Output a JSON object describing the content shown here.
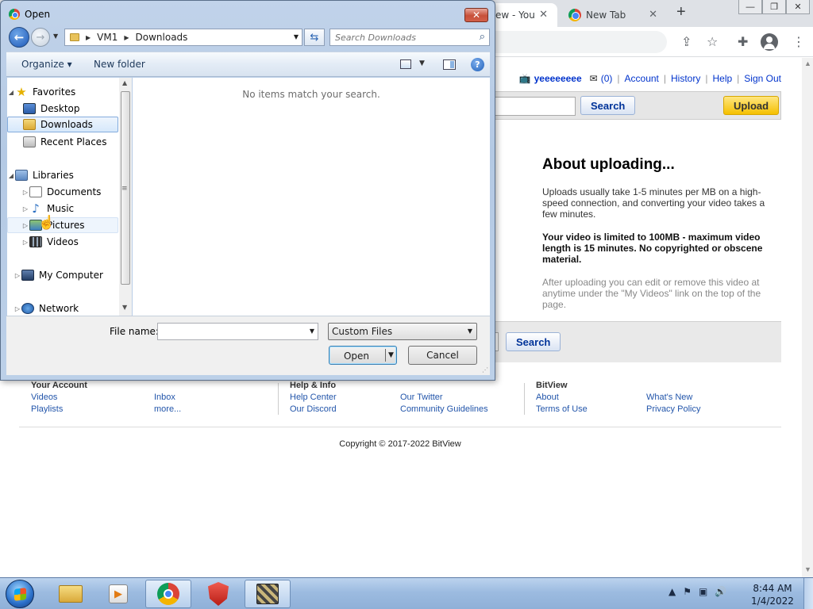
{
  "browser": {
    "tabs": [
      {
        "label": "ew - You"
      },
      {
        "label": "New Tab"
      }
    ]
  },
  "page": {
    "userbar": {
      "username": "yeeeeeeee",
      "messages": "(0)",
      "links": [
        "Account",
        "History",
        "Help",
        "Sign Out"
      ]
    },
    "search_button": "Search",
    "upload_button": "Upload",
    "about": {
      "title": "About uploading...",
      "p1": "Uploads usually take 1-5 minutes per MB on a high-speed connection, and converting your video takes a few minutes.",
      "p2": "Your video is limited to 100MB - maximum video length is 15 minutes. No copyrighted or obscene material.",
      "p3": "After uploading you can edit or remove this video at anytime under the \"My Videos\" link on the top of the page."
    },
    "bottom_search_button": "Search",
    "footer": {
      "col1": {
        "heading": "Your Account",
        "links_a": [
          "Videos",
          "Playlists"
        ],
        "links_b": [
          "Inbox",
          "more..."
        ]
      },
      "col2": {
        "heading": "Help & Info",
        "links_a": [
          "Help Center",
          "Our Discord"
        ],
        "links_b": [
          "Our Twitter",
          "Community Guidelines"
        ]
      },
      "col3": {
        "heading": "BitView",
        "links_a": [
          "About",
          "Terms of Use"
        ],
        "links_b": [
          "What's New",
          "Privacy Policy"
        ]
      }
    },
    "copyright": "Copyright © 2017-2022 BitView"
  },
  "dialog": {
    "title": "Open",
    "close_glyph": "✕",
    "breadcrumb": [
      "VM1",
      "Downloads"
    ],
    "search_placeholder": "Search Downloads",
    "commands": {
      "organize": "Organize ▾",
      "new_folder": "New folder",
      "help": "?"
    },
    "nav": {
      "favorites": "Favorites",
      "desktop": "Desktop",
      "downloads": "Downloads",
      "recent": "Recent Places",
      "libraries": "Libraries",
      "documents": "Documents",
      "music": "Music",
      "pictures": "Pictures",
      "videos": "Videos",
      "computer": "My Computer",
      "network": "Network"
    },
    "empty_message": "No items match your search.",
    "file_name_label": "File name:",
    "file_name_value": "",
    "filter": "Custom Files",
    "open_button": "Open",
    "cancel_button": "Cancel"
  },
  "taskbar": {
    "time": "8:44 AM",
    "date": "1/4/2022"
  }
}
